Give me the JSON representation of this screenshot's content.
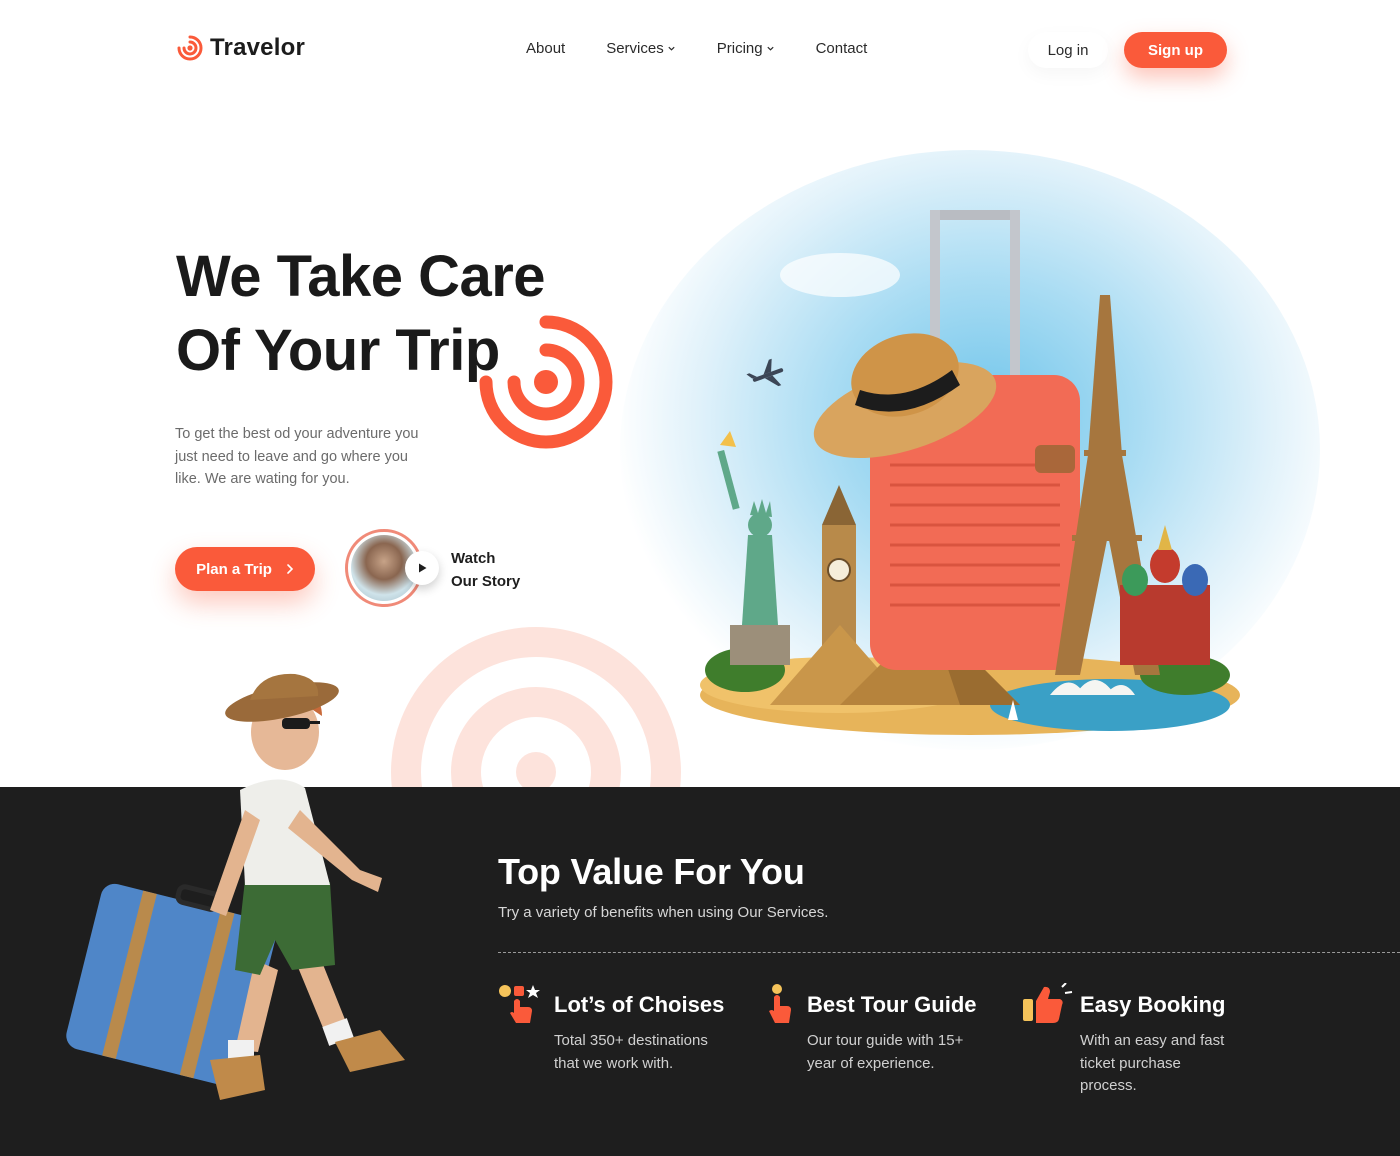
{
  "brand": {
    "name": "Travelor",
    "accent": "#fa5a3a",
    "dark_bg": "#1e1e1e"
  },
  "nav": {
    "about": "About",
    "services": "Services",
    "pricing": "Pricing",
    "contact": "Contact",
    "login": "Log in",
    "signup": "Sign up"
  },
  "hero": {
    "title_line1": "We Take Care",
    "title_line2": "Of Your Trip",
    "subtitle": "To get the best od your adventure you just need to leave and go where you like. We are wating for you.",
    "plan_button": "Plan a Trip",
    "story_line1": "Watch",
    "story_line2": "Our Story"
  },
  "values": {
    "title": "Top Value For You",
    "subtitle": "Try a variety of benefits when using Our Services.",
    "features": [
      {
        "icon": "shapes-hand-icon",
        "title": "Lot’s of Choises",
        "desc": "Total 350+ destinations that we work with."
      },
      {
        "icon": "pointer-hand-icon",
        "title": "Best Tour Guide",
        "desc": "Our tour guide with 15+ year of experience."
      },
      {
        "icon": "thumbs-up-icon",
        "title": "Easy Booking",
        "desc": "With an easy and fast ticket purchase process."
      }
    ]
  }
}
